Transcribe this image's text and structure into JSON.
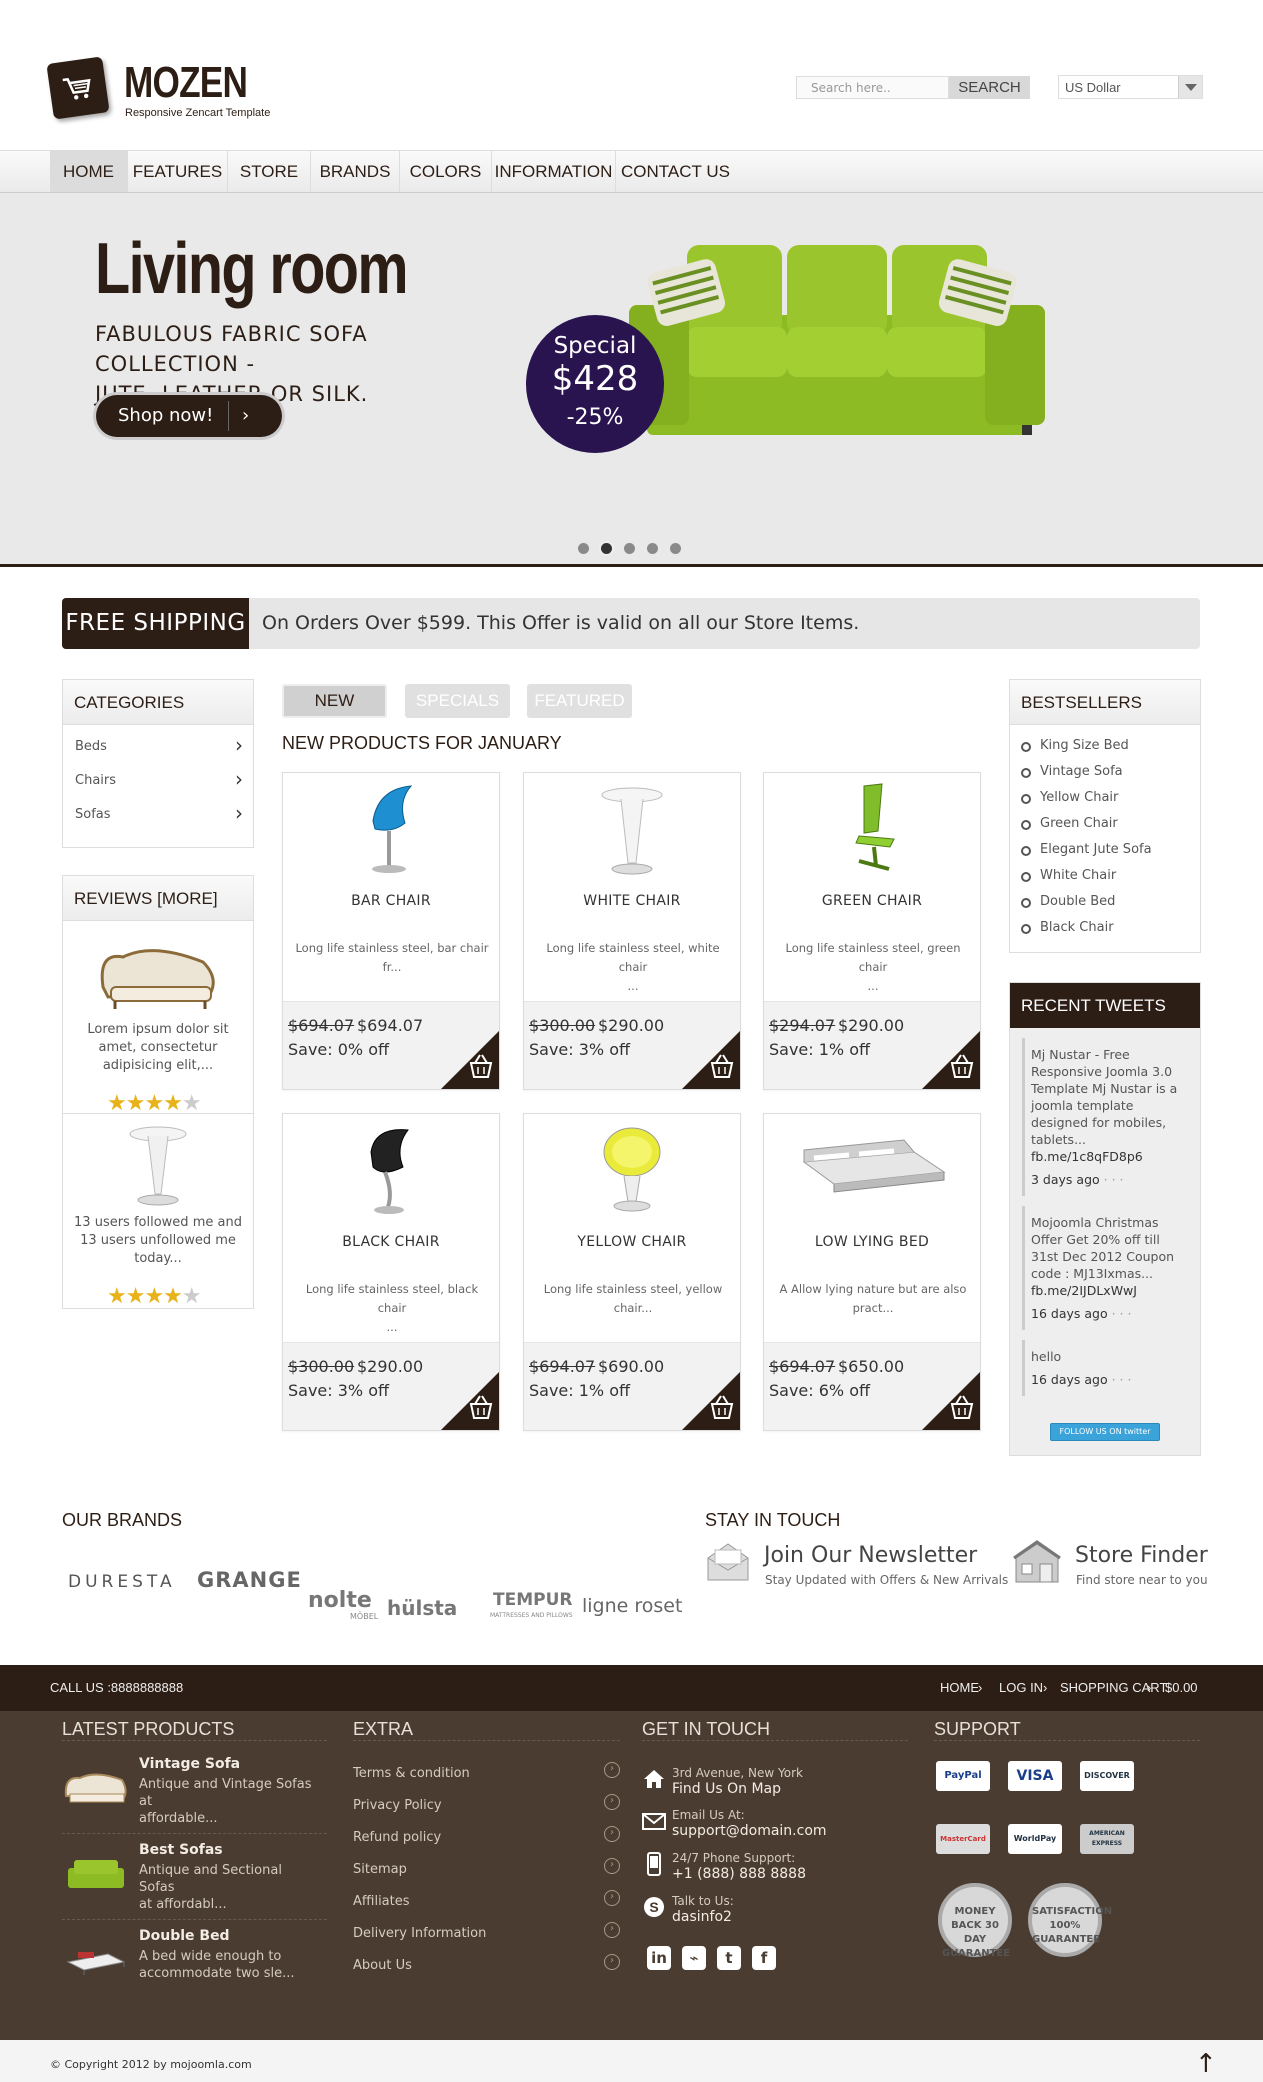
{
  "header": {
    "logo_title": "MOZEN",
    "logo_subtitle": "Responsive Zencart Template",
    "search_placeholder": "Search here..",
    "search_button": "SEARCH",
    "currency": "US Dollar"
  },
  "nav": {
    "items": [
      {
        "label": "HOME",
        "active": true
      },
      {
        "label": "FEATURES"
      },
      {
        "label": "STORE"
      },
      {
        "label": "BRANDS"
      },
      {
        "label": "COLORS"
      },
      {
        "label": "INFORMATION"
      },
      {
        "label": "CONTACT US"
      }
    ]
  },
  "hero": {
    "title": "Living room",
    "subtitle_line1": "FABULOUS FABRIC SOFA COLLECTION -",
    "subtitle_line2": "JUTE, LEATHER OR SILK.",
    "button": "Shop now!",
    "button_arrow": "›",
    "special_label": "Special",
    "special_price": "$428",
    "special_discount": "-25%",
    "slide_count": 5,
    "active_slide": 2
  },
  "shipping": {
    "label": "FREE SHIPPING",
    "text": "On Orders Over $599. This Offer is valid on all our Store Items."
  },
  "categories": {
    "title": "CATEGORIES",
    "items": [
      "Beds",
      "Chairs",
      "Sofas"
    ]
  },
  "reviews": {
    "title": "REVIEWS [MORE]",
    "items": [
      {
        "text": "Lorem ipsum dolor sit amet, consectetur adipisicing elit,...",
        "rating": 4
      },
      {
        "text": "13 users followed me and 13 users unfollowed me today...",
        "rating": 4
      }
    ]
  },
  "tabs": {
    "items": [
      "NEW",
      "SPECIALS",
      "FEATURED"
    ],
    "active": 0
  },
  "products_heading": "NEW PRODUCTS FOR JANUARY",
  "products": [
    {
      "name": "BAR CHAIR",
      "desc1": "Long life stainless steel, bar chair",
      "desc2": "fr...",
      "old": "$694.07",
      "new": "$694.07",
      "save": "Save: 0% off",
      "icon": "blue-bar-chair"
    },
    {
      "name": "WHITE CHAIR",
      "desc1": "Long life stainless steel, white chair",
      "desc2": "...",
      "old": "$300.00",
      "new": "$290.00",
      "save": "Save: 3% off",
      "icon": "white-bar-stool"
    },
    {
      "name": "GREEN CHAIR",
      "desc1": "Long life stainless steel, green chair",
      "desc2": "...",
      "old": "$294.07",
      "new": "$290.00",
      "save": "Save: 1% off",
      "icon": "green-chair"
    },
    {
      "name": "BLACK CHAIR",
      "desc1": "Long life stainless steel, black chair",
      "desc2": "...",
      "old": "$300.00",
      "new": "$290.00",
      "save": "Save: 3% off",
      "icon": "black-chair"
    },
    {
      "name": "YELLOW CHAIR",
      "desc1": "Long life stainless steel, yellow",
      "desc2": "chair...",
      "old": "$694.07",
      "new": "$690.00",
      "save": "Save: 1% off",
      "icon": "yellow-chair"
    },
    {
      "name": "LOW LYING BED",
      "desc1": "A Allow lying nature but are also",
      "desc2": "pract...",
      "old": "$694.07",
      "new": "$650.00",
      "save": "Save: 6% off",
      "icon": "low-bed"
    }
  ],
  "bestsellers": {
    "title": "BESTSELLERS",
    "items": [
      "King Size Bed",
      "Vintage Sofa",
      "Yellow Chair",
      "Green Chair",
      "Elegant Jute Sofa",
      "White Chair",
      "Double Bed",
      "Black Chair"
    ]
  },
  "tweets": {
    "title": "RECENT TWEETS",
    "items": [
      {
        "lines": [
          "Mj Nustar - Free",
          "Responsive Joomla 3.0",
          "Template Mj Nustar is a",
          "joomla template",
          "designed for mobiles,",
          "tablets...",
          "fb.me/1c8qFD8p6"
        ],
        "time": "3 days ago",
        "dots": "· · ·"
      },
      {
        "lines": [
          "Mojoomla Christmas",
          "Offer Get 20% off till",
          "31st Dec 2012 Coupon",
          "code : MJ13Ixmas...",
          "fb.me/2IJDLxWwJ"
        ],
        "time": "16 days ago",
        "dots": "· · ·"
      },
      {
        "lines": [
          "hello"
        ],
        "time": "16 days ago",
        "dots": "· · ·"
      }
    ],
    "follow": "FOLLOW US ON twitter"
  },
  "brands": {
    "title": "OUR BRANDS",
    "items": [
      "DURESTA",
      "GRANGE",
      "nolte",
      "MÖBEL",
      "hülsta",
      "TEMPUR",
      "MATTRESSES AND PILLOWS",
      "ligne roset"
    ]
  },
  "stay_in_touch": {
    "title": "STAY IN TOUCH",
    "newsletter_title": "Join Our Newsletter",
    "newsletter_sub": "Stay Updated with Offers & New Arrivals",
    "finder_title": "Store Finder",
    "finder_sub": "Find store near to you"
  },
  "footer": {
    "call_us": "CALL US :8888888888",
    "links": [
      "HOME",
      "LOG IN",
      "SHOPPING CART",
      "$0.00"
    ],
    "latest_title": "LATEST PRODUCTS",
    "latest": [
      {
        "name": "Vintage Sofa",
        "desc1": "Antique and Vintage Sofas at",
        "desc2": "affordable..."
      },
      {
        "name": "Best Sofas",
        "desc1": "Antique and Sectional Sofas",
        "desc2": "at affordabl..."
      },
      {
        "name": "Double Bed",
        "desc1": "A bed wide enough to",
        "desc2": "accommodate two sle..."
      }
    ],
    "extra_title": "EXTRA",
    "extra": [
      "Terms & condition",
      "Privacy Policy",
      "Refund policy",
      "Sitemap",
      "Affiliates",
      "Delivery Information",
      "About Us"
    ],
    "git_title": "GET IN TOUCH",
    "address1": "3rd Avenue, New York",
    "address2": "Find Us On Map",
    "email_label": "Email Us At:",
    "email": "support@domain.com",
    "phone_label": "24/7 Phone Support:",
    "phone": "+1 (888) 888 8888",
    "skype_label": "Talk to Us:",
    "skype": "dasinfo2",
    "support_title": "SUPPORT",
    "payments": [
      "PayPal",
      "VISA",
      "DISCOVER",
      "MasterCard",
      "WorldPay",
      "AMERICAN EXPRESS"
    ],
    "badge1": "MONEY BACK 30 DAY GUARANTEE",
    "badge2": "SATISFACTION 100% GUARANTEE",
    "copyright": "© Copyright 2012 by mojoomla.com"
  }
}
